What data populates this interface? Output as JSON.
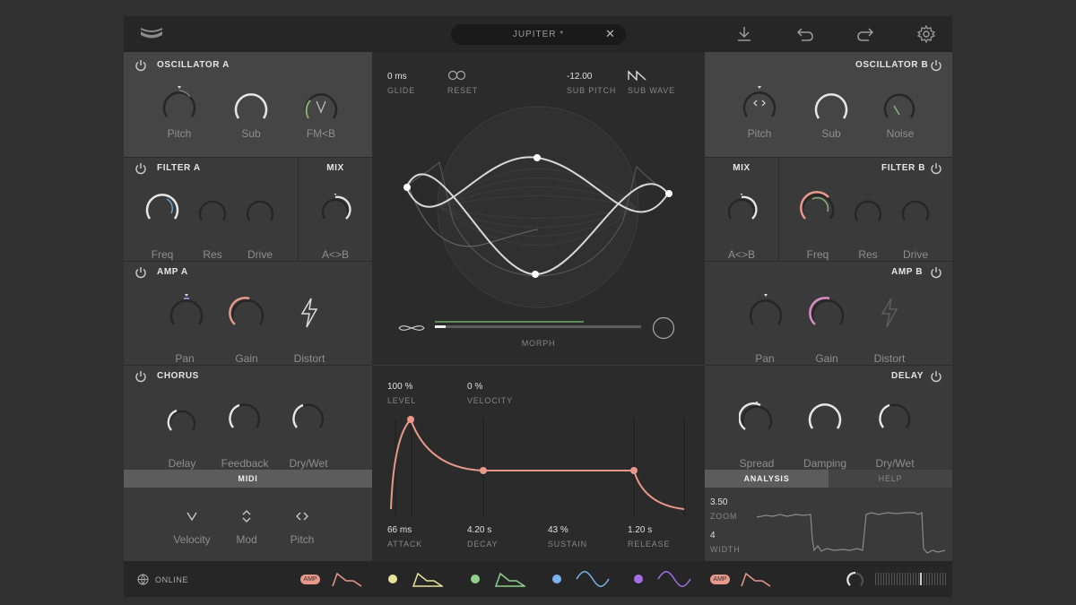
{
  "preset": {
    "name": "JUPITER *"
  },
  "oscillator_a": {
    "title": "OSCILLATOR A",
    "knobs": [
      {
        "label": "Pitch"
      },
      {
        "label": "Sub"
      },
      {
        "label": "FM<B"
      }
    ]
  },
  "filter_a": {
    "title": "FILTER A",
    "knobs": [
      {
        "label": "Freq"
      },
      {
        "label": "Res"
      },
      {
        "label": "Drive"
      }
    ]
  },
  "mix_a": {
    "title": "MIX",
    "knob": {
      "label": "A<>B"
    }
  },
  "amp_a": {
    "title": "AMP A",
    "knobs": [
      {
        "label": "Pan"
      },
      {
        "label": "Gain"
      },
      {
        "label": "Distort"
      }
    ]
  },
  "chorus": {
    "title": "CHORUS",
    "knobs": [
      {
        "label": "Delay"
      },
      {
        "label": "Feedback"
      },
      {
        "label": "Dry/Wet"
      }
    ]
  },
  "midi": {
    "title": "MIDI",
    "items": [
      {
        "label": "Velocity"
      },
      {
        "label": "Mod"
      },
      {
        "label": "Pitch"
      }
    ]
  },
  "oscillator_b": {
    "title": "OSCILLATOR B",
    "knobs": [
      {
        "label": "Pitch"
      },
      {
        "label": "Sub"
      },
      {
        "label": "Noise"
      }
    ]
  },
  "mix_b": {
    "title": "MIX",
    "knob": {
      "label": "A<>B"
    }
  },
  "filter_b": {
    "title": "FILTER B",
    "knobs": [
      {
        "label": "Freq"
      },
      {
        "label": "Res"
      },
      {
        "label": "Drive"
      }
    ]
  },
  "amp_b": {
    "title": "AMP B",
    "knobs": [
      {
        "label": "Pan"
      },
      {
        "label": "Gain"
      },
      {
        "label": "Distort"
      }
    ]
  },
  "delay": {
    "title": "DELAY",
    "knobs": [
      {
        "label": "Spread"
      },
      {
        "label": "Damping"
      },
      {
        "label": "Dry/Wet"
      }
    ]
  },
  "analysis": {
    "tabs": [
      {
        "label": "ANALYSIS"
      },
      {
        "label": "HELP"
      }
    ],
    "zoom": {
      "value": "3.50",
      "label": "ZOOM"
    },
    "width": {
      "value": "4",
      "label": "WIDTH"
    }
  },
  "center": {
    "glide": {
      "value": "0 ms",
      "label": "GLIDE"
    },
    "reset": {
      "label": "RESET"
    },
    "sub_pitch": {
      "value": "-12.00",
      "label": "SUB PITCH"
    },
    "sub_wave": {
      "label": "SUB WAVE"
    },
    "morph": {
      "label": "MORPH"
    }
  },
  "envelope": {
    "level": {
      "value": "100 %",
      "label": "LEVEL"
    },
    "velocity": {
      "value": "0 %",
      "label": "VELOCITY"
    },
    "attack": {
      "value": "66 ms",
      "label": "ATTACK"
    },
    "decay": {
      "value": "4.20 s",
      "label": "DECAY"
    },
    "sustain": {
      "value": "43 %",
      "label": "SUSTAIN"
    },
    "release": {
      "value": "1.20 s",
      "label": "RELEASE"
    }
  },
  "bottombar": {
    "status": "ONLINE",
    "amp_badge": "AMP",
    "lfo_colors": [
      "#e8e29a",
      "#8fd08c",
      "#7bb3f0",
      "#a36fe6"
    ],
    "accent": "#e8998a"
  }
}
